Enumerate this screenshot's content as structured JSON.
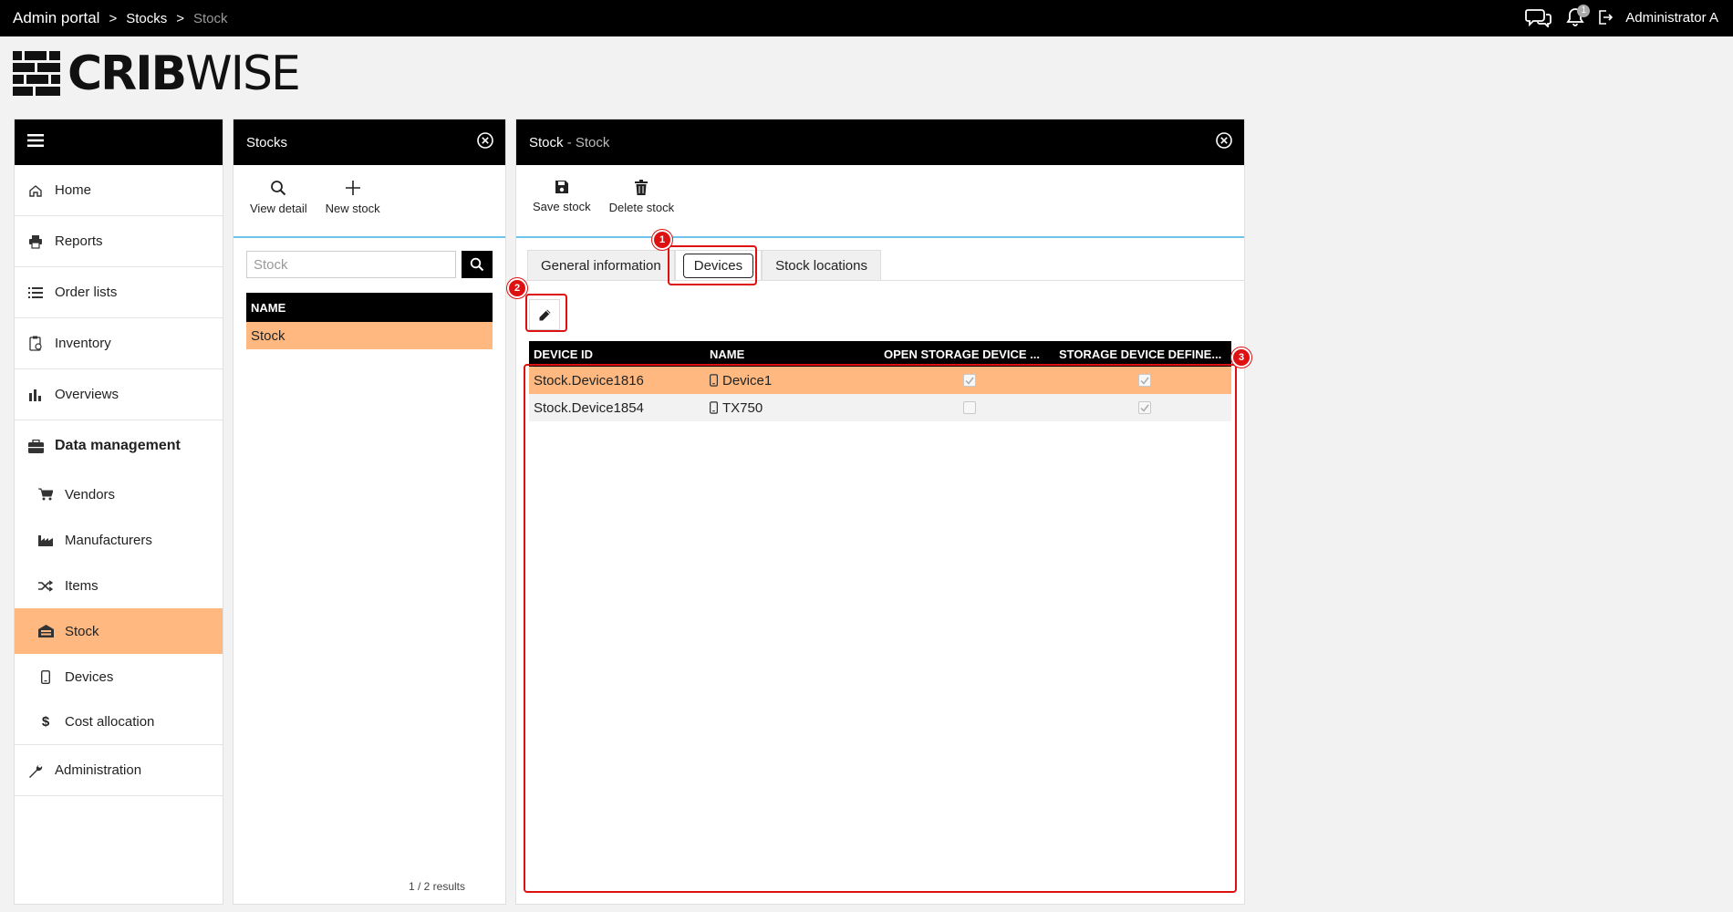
{
  "topbar": {
    "breadcrumb": [
      "Admin portal",
      "Stocks",
      "Stock"
    ],
    "separator": ">",
    "user": "Administrator A",
    "notification_count": "1"
  },
  "logo": {
    "bold": "CRIB",
    "light": "WISE"
  },
  "sidebar": {
    "items": [
      {
        "label": "Home",
        "icon": "home-icon"
      },
      {
        "label": "Reports",
        "icon": "printer-icon"
      },
      {
        "label": "Order lists",
        "icon": "list-icon"
      },
      {
        "label": "Inventory",
        "icon": "clipboard-icon"
      },
      {
        "label": "Overviews",
        "icon": "bar-chart-icon"
      },
      {
        "label": "Data management",
        "icon": "briefcase-icon"
      }
    ],
    "sub_items": [
      {
        "label": "Vendors",
        "icon": "cart-icon"
      },
      {
        "label": "Manufacturers",
        "icon": "factory-icon"
      },
      {
        "label": "Items",
        "icon": "shuffle-icon"
      },
      {
        "label": "Stock",
        "icon": "warehouse-icon"
      },
      {
        "label": "Devices",
        "icon": "mobile-icon"
      },
      {
        "label": "Cost allocation",
        "icon": "dollar-icon"
      }
    ],
    "administration": {
      "label": "Administration",
      "icon": "wrench-icon"
    }
  },
  "stocks_panel": {
    "title": "Stocks",
    "view_detail": "View detail",
    "new_stock": "New stock",
    "search_placeholder": "Stock",
    "column_name": "NAME",
    "rows": [
      "Stock"
    ],
    "results": "1 / 2 results"
  },
  "detail_panel": {
    "title": "Stock",
    "title_dash": "-",
    "subtitle": "Stock",
    "save": "Save stock",
    "delete": "Delete stock",
    "tabs": [
      "General information",
      "Devices",
      "Stock locations"
    ],
    "columns": [
      "DEVICE ID",
      "NAME",
      "OPEN STORAGE DEVICE ...",
      "STORAGE DEVICE DEFINE..."
    ],
    "rows": [
      {
        "device_id": "Stock.Device1816",
        "name": "Device1",
        "open_storage": true,
        "storage_defined": true
      },
      {
        "device_id": "Stock.Device1854",
        "name": "TX750",
        "open_storage": false,
        "storage_defined": true
      }
    ]
  },
  "annotations": [
    "1",
    "2",
    "3"
  ],
  "colors": {
    "accent": "#ffb980",
    "header": "#000000",
    "annotation": "#dd1111",
    "divider": "#6ec4e8"
  }
}
